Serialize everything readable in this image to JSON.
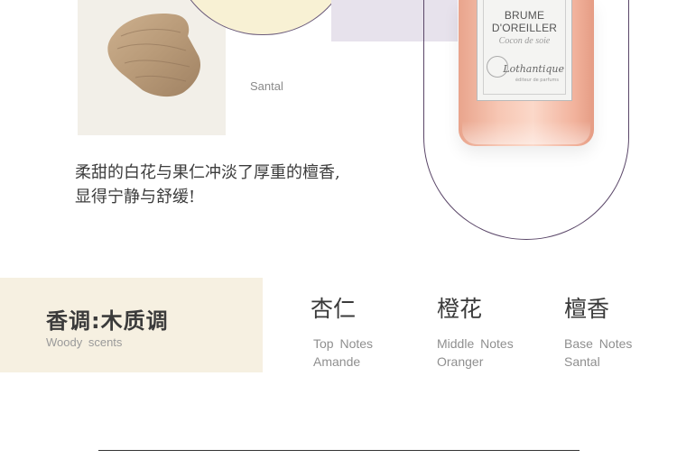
{
  "hero": {
    "santal_caption": "Santal",
    "bottle": {
      "label_title_line1": "BRUME",
      "label_title_line2": "D'OREILLER",
      "label_subtitle": "Cocon de soie",
      "brand": "Lothantique",
      "brand_tagline": "éditeur de parfums"
    }
  },
  "description": {
    "line1": "柔甜的白花与果仁冲淡了厚重的檀香,",
    "line2": "显得宁静与舒缓!"
  },
  "notes": {
    "heading": "香调:木质调",
    "heading_en": "Woody  scents",
    "items": [
      {
        "cn": "杏仁",
        "en_label": "Top  Notes",
        "en_name": "Amande"
      },
      {
        "cn": "橙花",
        "en_label": "Middle  Notes",
        "en_name": "Oranger"
      },
      {
        "cn": "檀香",
        "en_label": "Base  Notes",
        "en_name": "Santal"
      }
    ]
  },
  "colors": {
    "panel_cream": "#f6f0e1",
    "frame_purple": "#5a4668",
    "bottle_pink": "#f7c7b4"
  }
}
